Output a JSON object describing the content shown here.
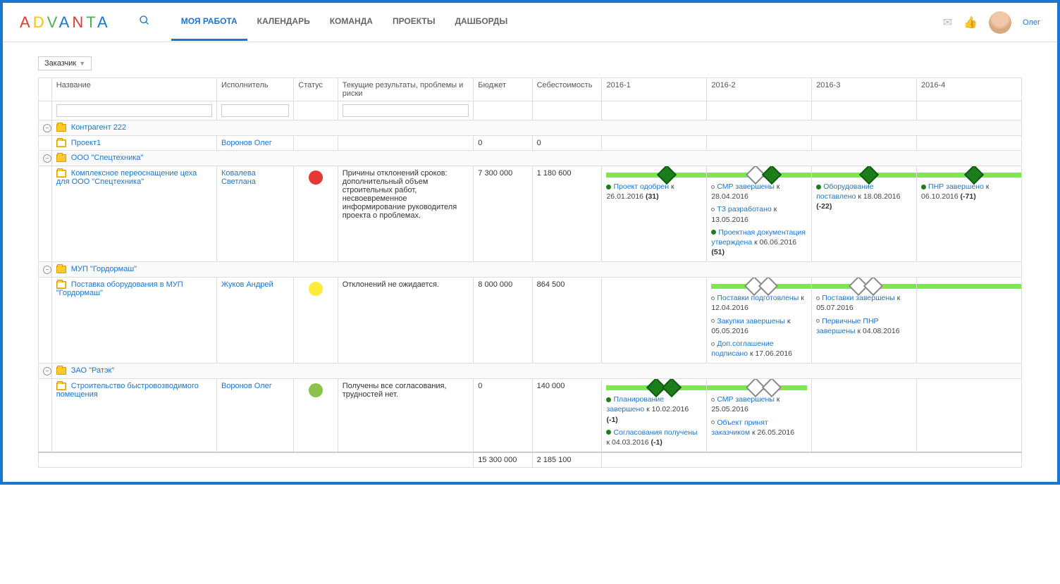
{
  "header": {
    "nav": [
      "МОЯ РАБОТА",
      "КАЛЕНДАРЬ",
      "КОМАНДА",
      "ПРОЕКТЫ",
      "ДАШБОРДЫ"
    ],
    "username": "Олег"
  },
  "dropdown": {
    "label": "Заказчик"
  },
  "columns": {
    "name": "Название",
    "executor": "Исполнитель",
    "status": "Статус",
    "results": "Текущие результаты, проблемы и риски",
    "budget": "Бюджет",
    "cost": "Себестоимость",
    "q1": "2016-1",
    "q2": "2016-2",
    "q3": "2016-3",
    "q4": "2016-4"
  },
  "groups": [
    {
      "name": "Контрагент 222",
      "projects": [
        {
          "name": "Проект1",
          "executor": "Воронов Олег",
          "status": "",
          "results": "",
          "budget": "0",
          "cost": "0",
          "timeline": []
        }
      ]
    },
    {
      "name": "ООО \"Спецтехника\"",
      "projects": [
        {
          "name": "Комплексное переоснащение цеха для ООО \"Спецтехника\"",
          "executor": "Ковалева Светлана",
          "status": "red",
          "results": "Причины отклонений сроков: дополнительный объем строительных работ, несвоевременное информирование руководителя проекта о проблемах.",
          "budget": "7 300 000",
          "cost": "1 180 600",
          "timeline": {
            "barFrom": 0,
            "barTo": 4,
            "diamonds": [
              {
                "col": 0,
                "pos": 55,
                "type": "green"
              },
              {
                "col": 1,
                "pos": 40,
                "type": "white"
              },
              {
                "col": 1,
                "pos": 55,
                "type": "green"
              },
              {
                "col": 2,
                "pos": 48,
                "type": "green"
              },
              {
                "col": 3,
                "pos": 48,
                "type": "green"
              }
            ],
            "cols": [
              [
                {
                  "dot": "filled",
                  "title": "Проект одобрен",
                  "date": "к 26.01.2016",
                  "delta": "(31)"
                }
              ],
              [
                {
                  "dot": "empty",
                  "title": "СМР завершены",
                  "date": "к 28.04.2016"
                },
                {
                  "dot": "empty",
                  "title": "ТЗ разработано",
                  "date": "к 13.05.2016"
                },
                {
                  "dot": "filled",
                  "title": "Проектная документация утверждена",
                  "date": "к 06.06.2016",
                  "delta": "(51)"
                }
              ],
              [
                {
                  "dot": "filled",
                  "title": "Оборудование поставлено",
                  "date": "к 18.08.2016",
                  "delta": "(-22)"
                }
              ],
              [
                {
                  "dot": "filled",
                  "title": "ПНР завершено",
                  "date": "к 06.10.2016",
                  "delta": "(-71)"
                }
              ]
            ]
          }
        }
      ]
    },
    {
      "name": "МУП \"Гордормаш\"",
      "projects": [
        {
          "name": "Поставка оборудования в МУП \"Гордормаш\"",
          "executor": "Жуков Андрей",
          "status": "yellow",
          "results": "Отклонений не ожидается.",
          "budget": "8 000 000",
          "cost": "864 500",
          "timeline": {
            "barFrom": 1,
            "barTo": 4,
            "diamonds": [
              {
                "col": 1,
                "pos": 38,
                "type": "white"
              },
              {
                "col": 1,
                "pos": 52,
                "type": "white"
              },
              {
                "col": 2,
                "pos": 38,
                "type": "white"
              },
              {
                "col": 2,
                "pos": 52,
                "type": "white"
              }
            ],
            "cols": [
              [],
              [
                {
                  "dot": "empty",
                  "title": "Поставки подготовлены",
                  "date": "к 12.04.2016"
                },
                {
                  "dot": "empty",
                  "title": "Закупки завершены",
                  "date": "к 05.05.2016"
                },
                {
                  "dot": "empty",
                  "title": "Доп.соглашение подписано",
                  "date": "к 17.06.2016"
                }
              ],
              [
                {
                  "dot": "empty",
                  "title": "Поставки завершены",
                  "date": "к 05.07.2016"
                },
                {
                  "dot": "empty",
                  "title": "Первичные ПНР завершены",
                  "date": "к 04.08.2016"
                }
              ],
              []
            ]
          }
        }
      ]
    },
    {
      "name": "ЗАО \"Ратэк\"",
      "projects": [
        {
          "name": "Строительство быстровозводимого помещения",
          "executor": "Воронов Олег",
          "status": "green",
          "results": "Получены все согласования, трудностей нет.",
          "budget": "0",
          "cost": "140 000",
          "timeline": {
            "barFrom": 0,
            "barTo": 2,
            "diamonds": [
              {
                "col": 0,
                "pos": 45,
                "type": "green"
              },
              {
                "col": 0,
                "pos": 60,
                "type": "green"
              },
              {
                "col": 1,
                "pos": 40,
                "type": "white"
              },
              {
                "col": 1,
                "pos": 55,
                "type": "white"
              }
            ],
            "cols": [
              [
                {
                  "dot": "filled",
                  "title": "Планирование завершено",
                  "date": "к 10.02.2016",
                  "delta": "(-1)"
                },
                {
                  "dot": "filled",
                  "title": "Согласования получены",
                  "date": "к 04.03.2016",
                  "delta": "(-1)"
                }
              ],
              [
                {
                  "dot": "empty",
                  "title": "СМР завершены",
                  "date": "к 25.05.2016"
                },
                {
                  "dot": "empty",
                  "title": "Объект принят заказчиком",
                  "date": "к 26.05.2016"
                }
              ],
              [],
              []
            ]
          }
        }
      ]
    }
  ],
  "totals": {
    "budget": "15 300 000",
    "cost": "2 185 100"
  }
}
